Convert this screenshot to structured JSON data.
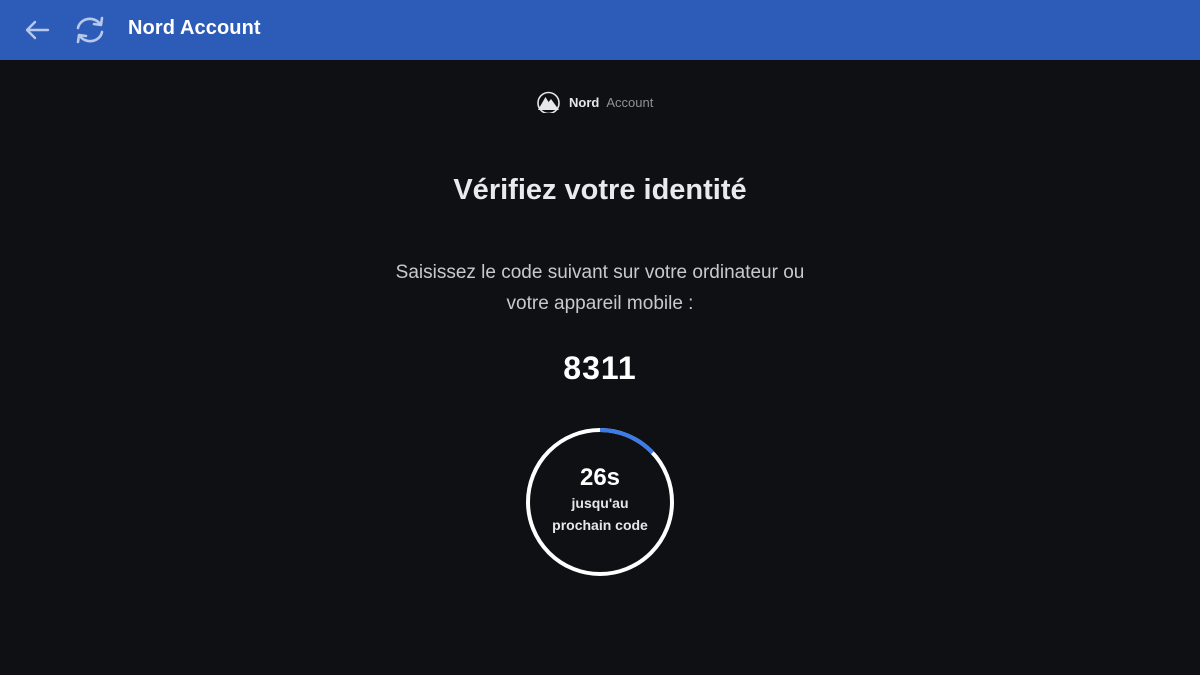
{
  "appbar": {
    "title": "Nord Account",
    "back_icon": "arrow-left-icon",
    "refresh_icon": "refresh-icon",
    "color": "#2c5cb8"
  },
  "logo": {
    "icon": "nord-mountain-icon",
    "brand_bold": "Nord",
    "brand_light": "Account"
  },
  "verify": {
    "heading": "Vérifiez votre identité",
    "instruction_line1": "Saisissez le code suivant sur votre ordinateur ou",
    "instruction_line2": "votre appareil mobile :",
    "code": "8311"
  },
  "timer": {
    "seconds_label": "26s",
    "until_line1": "jusqu'au",
    "until_line2": "prochain code",
    "elapsed_fraction": 0.13,
    "ring_color": "#ffffff",
    "elapsed_color": "#3b7bea"
  }
}
